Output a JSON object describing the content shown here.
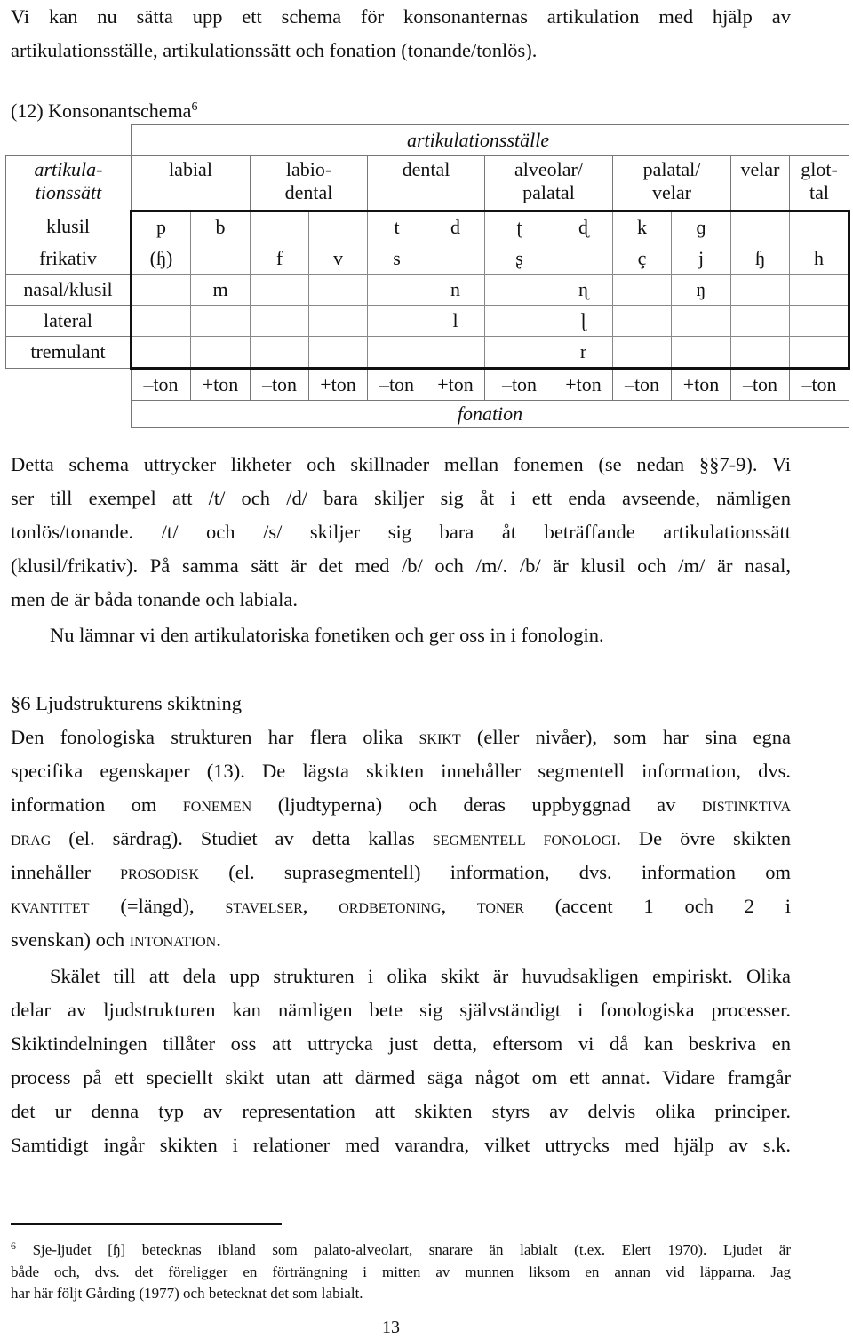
{
  "intro": {
    "line1": "Vi kan nu sätta upp ett schema för konsonanternas artikulation med hjälp av",
    "line2": "artikulationsställe, artikulationssätt och fonation (tonande/tonlös)."
  },
  "table": {
    "caption": "(12) Konsonantschema",
    "caption_footnote_mark": "6",
    "place_header": "artikulationsställe",
    "manner_header": "artikula-\ntionssätt",
    "places": [
      {
        "label_line1": "labial",
        "label_line2": ""
      },
      {
        "label_line1": "labio-",
        "label_line2": "dental"
      },
      {
        "label_line1": "dental",
        "label_line2": ""
      },
      {
        "label_line1": "alveolar/",
        "label_line2": "palatal"
      },
      {
        "label_line1": "palatal/",
        "label_line2": "velar"
      },
      {
        "label_line1": "velar",
        "label_line2": ""
      },
      {
        "label_line1": "glot-",
        "label_line2": "tal"
      }
    ],
    "rows": [
      {
        "manner": "klusil",
        "cells": [
          "p",
          "b",
          "",
          "",
          "t",
          "d",
          "ʈ",
          "ɖ",
          "k",
          "ɡ",
          "",
          ""
        ]
      },
      {
        "manner": "frikativ",
        "cells": [
          "(ɧ)",
          "",
          "f",
          "v",
          "s",
          "",
          "ʂ",
          "",
          "ç",
          "j",
          "ɧ",
          "h"
        ]
      },
      {
        "manner": "nasal/klusil",
        "cells": [
          "",
          "m",
          "",
          "",
          "",
          "n",
          "",
          "ɳ",
          "",
          "ŋ",
          "",
          ""
        ]
      },
      {
        "manner": "lateral",
        "cells": [
          "",
          "",
          "",
          "",
          "",
          "l",
          "",
          "ɭ",
          "",
          "",
          "",
          ""
        ]
      },
      {
        "manner": "tremulant",
        "cells": [
          "",
          "",
          "",
          "",
          "",
          "",
          "",
          "r",
          "",
          "",
          "",
          ""
        ]
      }
    ],
    "phonation": [
      "–ton",
      "+ton",
      "–ton",
      "+ton",
      "–ton",
      "+ton",
      "–ton",
      "+ton",
      "–ton",
      "+ton",
      "–ton",
      "–ton"
    ],
    "phonation_label": "fonation"
  },
  "para1": {
    "lines": [
      "Detta schema uttrycker likheter och skillnader mellan fonemen (se nedan §§7-9). Vi",
      "ser till exempel att /t/ och /d/ bara skiljer sig åt i ett enda avseende, nämligen",
      "tonlös/tonande. /t/ och /s/ skiljer sig bara åt beträffande artikulationssätt",
      "(klusil/frikativ). På samma sätt är det med /b/ och /m/. /b/ är klusil och /m/ är nasal,",
      "men de är båda tonande och labiala."
    ]
  },
  "para2": "Nu lämnar vi den artikulatoriska fonetiken och ger oss in i fonologin.",
  "section": {
    "heading": "§6 Ljudstrukturens skiktning",
    "lines": [
      [
        "Den fonologiska strukturen har flera olika ",
        {
          "sc": "skikt"
        },
        " (eller nivåer), som har sina egna"
      ],
      [
        "specifika egenskaper (13). De lägsta skikten innehåller segmentell information, dvs."
      ],
      [
        "information om ",
        {
          "sc": "fonemen"
        },
        " (ljudtyperna) och deras uppbyggnad av ",
        {
          "sc": "distinktiva"
        }
      ],
      [
        {
          "sc": "drag"
        },
        " (el. särdrag). Studiet av detta kallas ",
        {
          "sc": "segmentell fonologi"
        },
        ". De övre skikten"
      ],
      [
        "innehåller ",
        {
          "sc": "prosodisk"
        },
        " (el. suprasegmentell) information, dvs. information om"
      ],
      [
        {
          "sc": "kvantitet"
        },
        " (=längd), ",
        {
          "sc": "stavelser"
        },
        ", ",
        {
          "sc": "ordbetoning"
        },
        ", ",
        {
          "sc": "toner"
        },
        " (accent 1 och 2 i"
      ],
      [
        "svenskan) och ",
        {
          "sc": "intonation"
        },
        "."
      ]
    ]
  },
  "para3": {
    "lines": [
      "Skälet till att dela upp strukturen i olika skikt är huvudsakligen empiriskt. Olika",
      "delar av ljudstrukturen kan nämligen bete sig självständigt i fonologiska processer.",
      "Skiktindelningen tillåter oss att uttrycka just detta, eftersom vi då kan beskriva en",
      "process på ett speciellt skikt utan att därmed säga något om ett annat. Vidare framgår",
      "det ur denna typ av representation att skikten styrs av delvis olika principer.",
      "Samtidigt ingår skikten i relationer med varandra, vilket uttrycks med hjälp av s.k."
    ]
  },
  "footnote": {
    "mark": "6",
    "lines": [
      "Sje-ljudet [ɧ] betecknas ibland som palato-alveolart, snarare än labialt (t.ex. Elert 1970). Ljudet är",
      "både och, dvs. det föreligger en förträngning i mitten av munnen liksom en annan vid läpparna. Jag",
      "har här följt Gårding (1977) och betecknat det som labialt."
    ]
  },
  "page_number": "13"
}
